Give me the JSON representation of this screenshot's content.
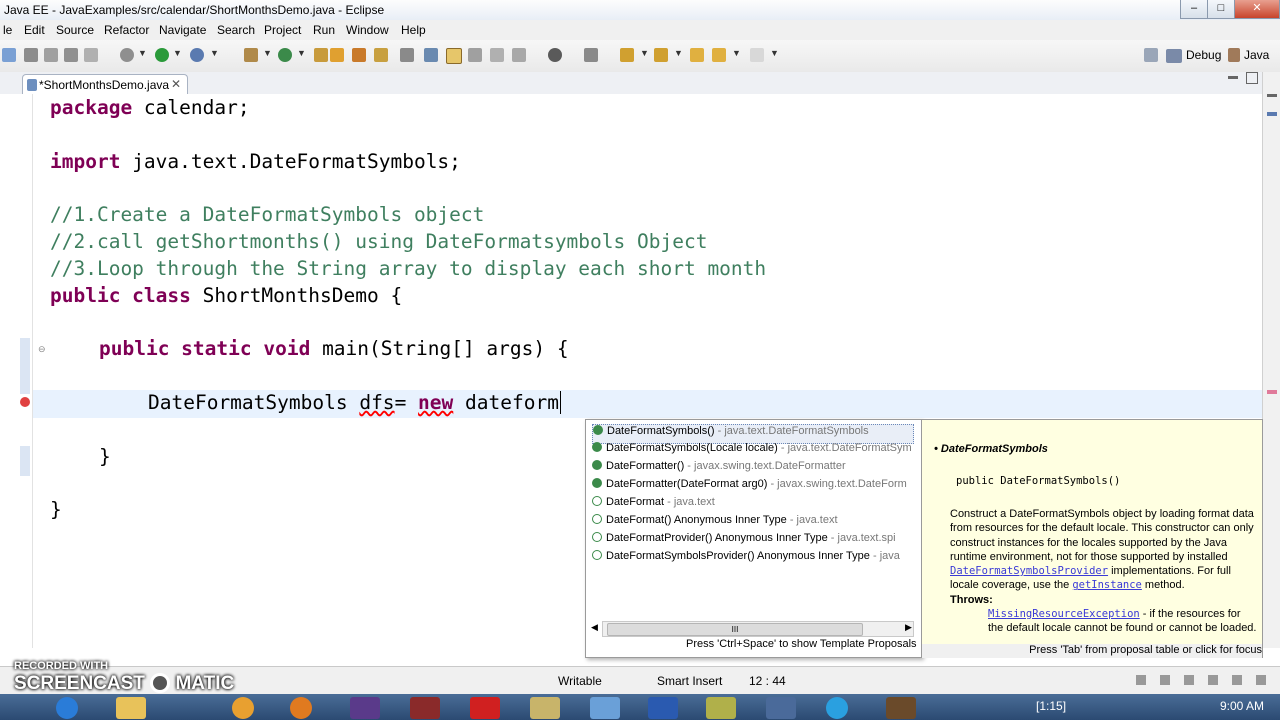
{
  "window": {
    "title": "Java EE - JavaExamples/src/calendar/ShortMonthsDemo.java - Eclipse",
    "minimize": "–",
    "maximize": "□",
    "close": "✕"
  },
  "menu": [
    "le",
    "Edit",
    "Source",
    "Refactor",
    "Navigate",
    "Search",
    "Project",
    "Run",
    "Window",
    "Help"
  ],
  "perspectives": {
    "debug": "Debug",
    "java": "Java"
  },
  "editor_tab": {
    "label": "*ShortMonthsDemo.java",
    "close": "✕"
  },
  "code": {
    "l1": {
      "kw": "package",
      "rest": " calendar;"
    },
    "l2": {
      "kw": "import",
      "rest": " java.text.DateFormatSymbols;"
    },
    "c1": "//1.Create a DateFormatSymbols object",
    "c2": "//2.call getShortmonths() using DateFormatsymbols Object",
    "c3": "//3.Loop through the String array to display each short month",
    "l3": {
      "kw": "public class",
      "rest": " ShortMonthsDemo {"
    },
    "l4": {
      "kw": "public static void",
      "rest": " main(String[] args) {"
    },
    "l5": {
      "a": "DateFormatSymbols ",
      "err": "dfs",
      "b": "= ",
      "kw": "new",
      "c": " dateform"
    },
    "close1": "}",
    "close2": "}"
  },
  "proposals": [
    {
      "name": "DateFormatSymbols()",
      "sub": " - java.text.DateFormatSymbols",
      "icon": "constructor-icon",
      "selected": true
    },
    {
      "name": "DateFormatSymbols(Locale locale)",
      "sub": " - java.text.DateFormatSym",
      "icon": "constructor-icon"
    },
    {
      "name": "DateFormatter()",
      "sub": " - javax.swing.text.DateFormatter",
      "icon": "constructor-icon"
    },
    {
      "name": "DateFormatter(DateFormat arg0)",
      "sub": " - javax.swing.text.DateForm",
      "icon": "constructor-icon"
    },
    {
      "name": "DateFormat",
      "sub": " - java.text",
      "icon": "abstract-class-icon"
    },
    {
      "name": "DateFormat()  Anonymous Inner Type",
      "sub": " - java.text",
      "icon": "anonymous-type-icon"
    },
    {
      "name": "DateFormatProvider()  Anonymous Inner Type",
      "sub": " - java.text.spi",
      "icon": "anonymous-type-icon"
    },
    {
      "name": "DateFormatSymbolsProvider()  Anonymous Inner Type",
      "sub": " - java",
      "icon": "anonymous-type-icon"
    }
  ],
  "popup_hint": "Press 'Ctrl+Space' to show Template Proposals",
  "hscroll_grip": "III",
  "doc": {
    "title": "DateFormatSymbols",
    "signature": "public DateFormatSymbols()",
    "text1": "Construct a DateFormatSymbols object by loading format data from resources for the default locale. This constructor can only construct instances for the locales supported by the Java runtime environment, not for those supported by installed",
    "link1": "DateFormatSymbolsProvider",
    "text2": " implementations. For full locale coverage, use the",
    "link2": "getInstance",
    "text3": " method.",
    "throws_label": "Throws:",
    "link3": "MissingResourceException",
    "text4": " - if the resources for the default locale cannot be found or cannot be loaded.",
    "hint": "Press 'Tab' from proposal table or click for focus"
  },
  "status": {
    "writable": "Writable",
    "insert": "Smart Insert",
    "position": "12 : 44"
  },
  "watermark": {
    "line1": "RECORDED WITH",
    "line2a": "SCREENCAST",
    "line2b": "MATIC"
  },
  "taskbar": {
    "clock": "9:00 AM",
    "task_label": "[1:15]"
  },
  "colors": {
    "keyword": "#7f0055",
    "comment": "#3f7f5f",
    "current_line": "#e8f2fe",
    "doc_bg": "#ffffe1"
  }
}
